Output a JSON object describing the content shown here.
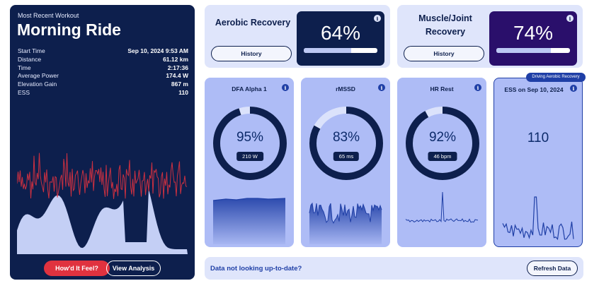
{
  "workout": {
    "eyebrow": "Most Recent Workout",
    "title": "Morning Ride",
    "stats": [
      {
        "label": "Start Time",
        "value": "Sep 10, 2024 9:53 AM"
      },
      {
        "label": "Distance",
        "value": "61.12 km"
      },
      {
        "label": "Time",
        "value": "2:17:36"
      },
      {
        "label": "Average Power",
        "value": "174.4 W"
      },
      {
        "label": "Elevation Gain",
        "value": "867 m"
      },
      {
        "label": "ESS",
        "value": "110"
      }
    ],
    "feel_label": "How'd It Feel?",
    "analysis_label": "View Analysis"
  },
  "aerobic": {
    "label": "Aerobic Recovery",
    "history_label": "History",
    "percent_text": "64%",
    "percent": 64,
    "color": "#0d1f4d"
  },
  "muscle": {
    "label": "Muscle/Joint Recovery",
    "history_label": "History",
    "percent_text": "74%",
    "percent": 74,
    "color": "#2a0f6b"
  },
  "metrics": [
    {
      "title": "DFA Alpha 1",
      "percent_text": "95%",
      "percent": 95,
      "detail": "210 W",
      "icon": "info-icon"
    },
    {
      "title": "rMSSD",
      "percent_text": "83%",
      "percent": 83,
      "detail": "65 ms",
      "icon": "info-icon"
    },
    {
      "title": "HR Rest",
      "percent_text": "92%",
      "percent": 92,
      "detail": "46 bpm",
      "icon": "info-icon"
    }
  ],
  "ess": {
    "title": "ESS on Sep 10, 2024",
    "value": "110",
    "badge": "Driving Aerobic Recovery"
  },
  "footer": {
    "message": "Data not looking up-to-date?",
    "refresh_label": "Refresh Data"
  },
  "colors": {
    "navy": "#0d1f4d",
    "card_blue": "#aebcf6",
    "light_panel": "#dfe5fb",
    "accent_red": "#e0323f",
    "ring_track": "#dbe2fb"
  }
}
